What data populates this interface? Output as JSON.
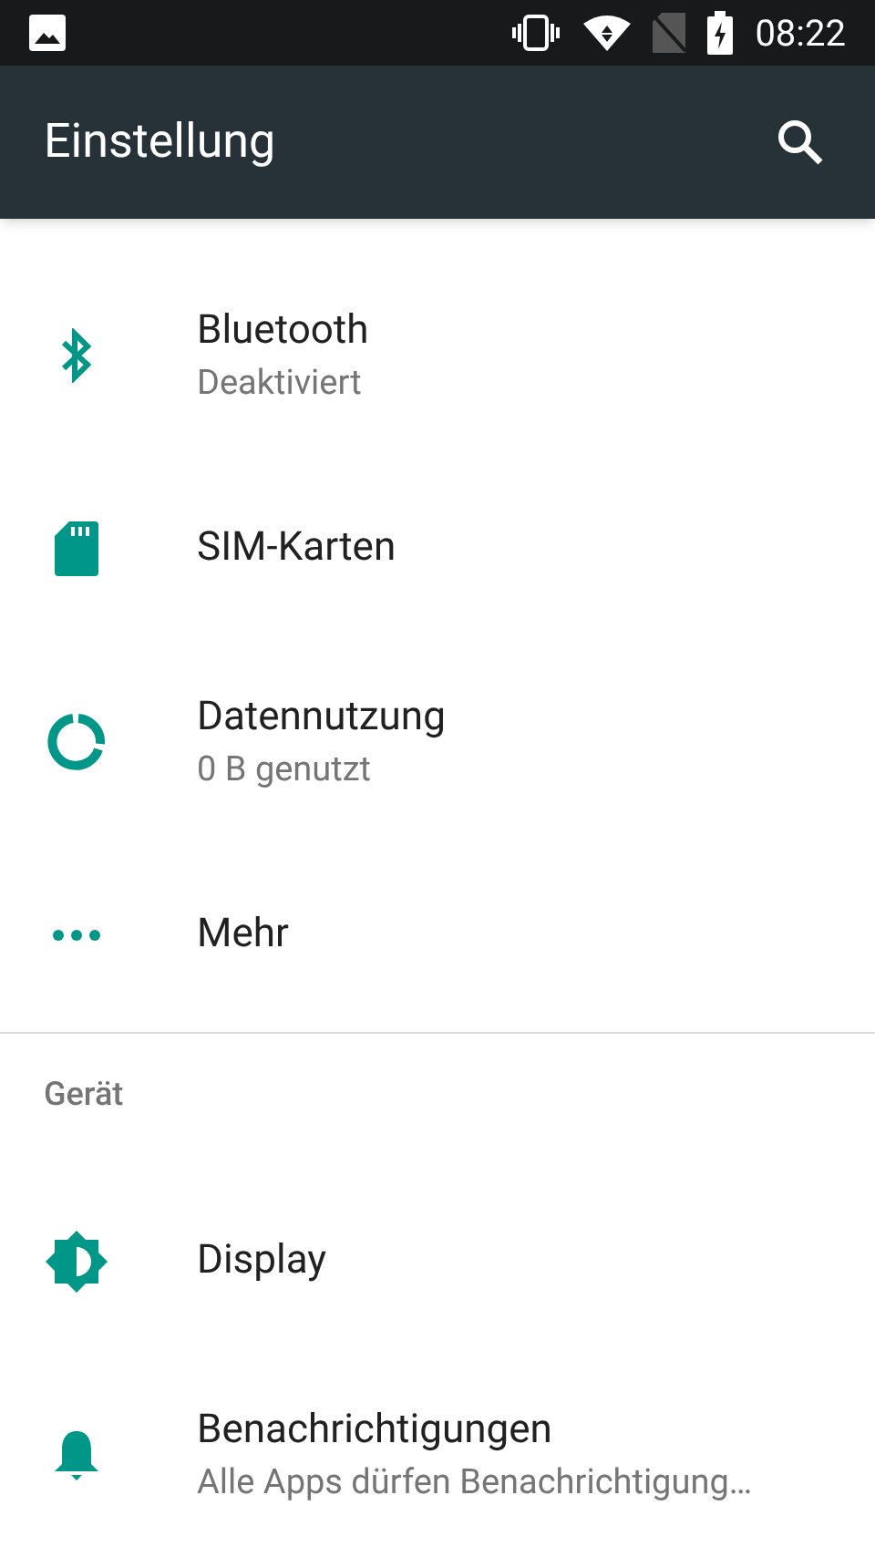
{
  "status_bar": {
    "time": "08:22"
  },
  "toolbar": {
    "title": "Einstellung"
  },
  "sections": [
    {
      "items": [
        {
          "title": "Bluetooth",
          "subtitle": "Deaktiviert"
        },
        {
          "title": "SIM-Karten"
        },
        {
          "title": "Datennutzung",
          "subtitle": "0 B genutzt"
        },
        {
          "title": "Mehr"
        }
      ]
    },
    {
      "header": "Gerät",
      "items": [
        {
          "title": "Display"
        },
        {
          "title": "Benachrichtigungen",
          "subtitle": "Alle Apps dürfen Benachrichtigung…"
        }
      ]
    }
  ]
}
